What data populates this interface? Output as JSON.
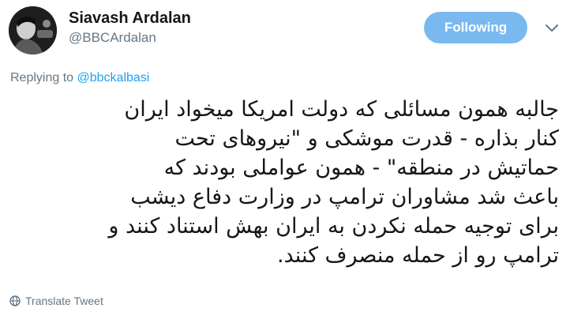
{
  "author": {
    "name": "Siavash Ardalan",
    "handle": "@BBCArdalan"
  },
  "follow_button": {
    "label": "Following",
    "color": "#79b9ef"
  },
  "menu_icon": "chevron-down-icon",
  "reply": {
    "prefix": "Replying to ",
    "mention": "@bbckalbasi",
    "mention_color": "#1da1f2"
  },
  "tweet": {
    "lines": [
      "جالبه همون مسائلی که دولت امریکا میخواد ایران",
      "کنار بذاره - قدرت موشکی و \"نیروهای تحت",
      "حماتیش در منطقه\" - همون عواملی بودند که",
      "باعث شد مشاوران ترامپ در وزارت دفاع دیشب",
      "برای توجیه حمله نکردن به ایران بهش استناد کنند و",
      "ترامپ رو از حمله منصرف کنند."
    ]
  },
  "translate": {
    "label": "Translate Tweet",
    "icon": "globe-icon"
  }
}
